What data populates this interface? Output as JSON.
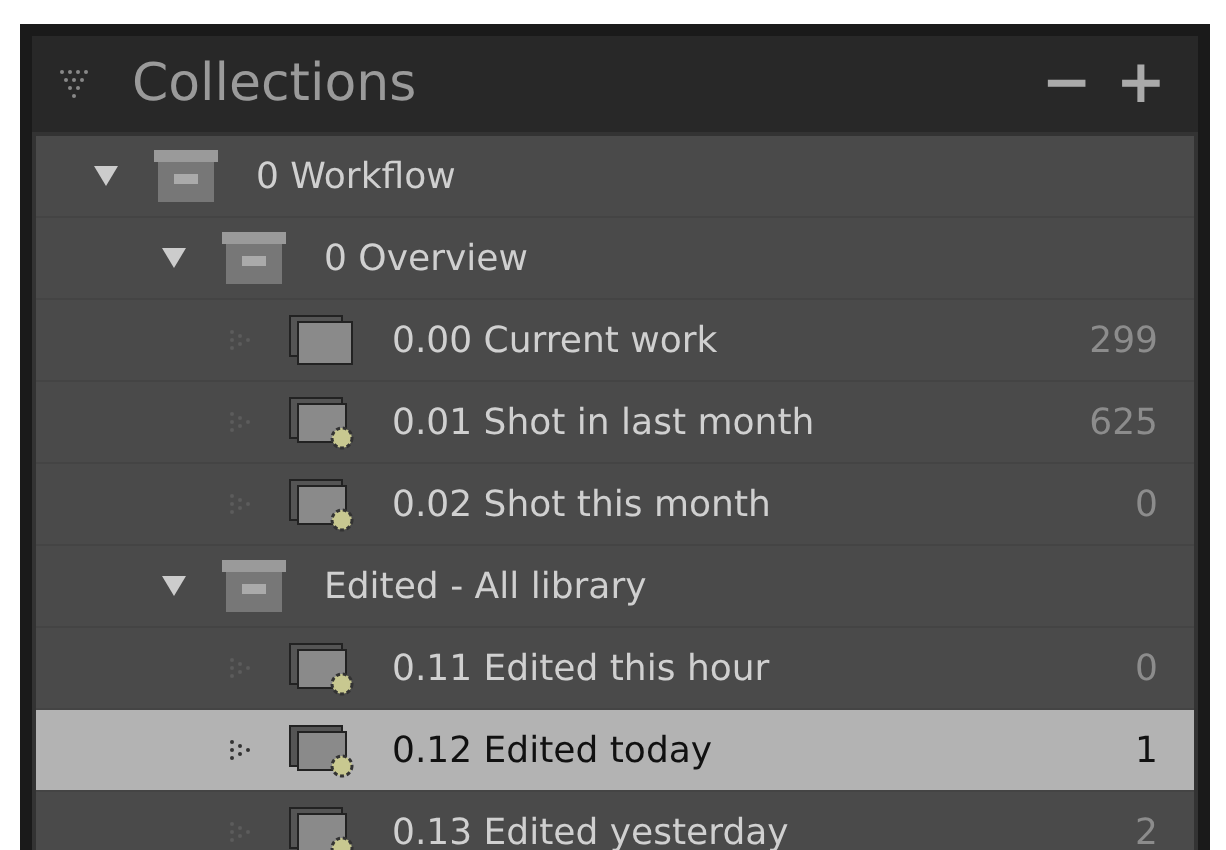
{
  "panel": {
    "title": "Collections",
    "actions": [
      "−",
      "+"
    ]
  },
  "collections": [
    {
      "kind": "set",
      "name": "0 Workflow",
      "expanded": true,
      "children": [
        {
          "kind": "set",
          "name": "0 Overview",
          "expanded": true,
          "children": [
            {
              "kind": "collection",
              "name": "0.00 Current work",
              "count": "299",
              "selected": false
            },
            {
              "kind": "smart",
              "name": "0.01 Shot in last month",
              "count": "625",
              "selected": false
            },
            {
              "kind": "smart",
              "name": "0.02 Shot this month",
              "count": "0",
              "selected": false
            }
          ]
        },
        {
          "kind": "set",
          "name": "Edited - All library",
          "expanded": true,
          "children": [
            {
              "kind": "smart",
              "name": "0.11 Edited this hour",
              "count": "0",
              "selected": false
            },
            {
              "kind": "smart",
              "name": "0.12 Edited today",
              "count": "1",
              "selected": true
            },
            {
              "kind": "smart",
              "name": "0.13 Edited yesterday",
              "count": "2",
              "selected": false
            }
          ]
        }
      ]
    }
  ]
}
